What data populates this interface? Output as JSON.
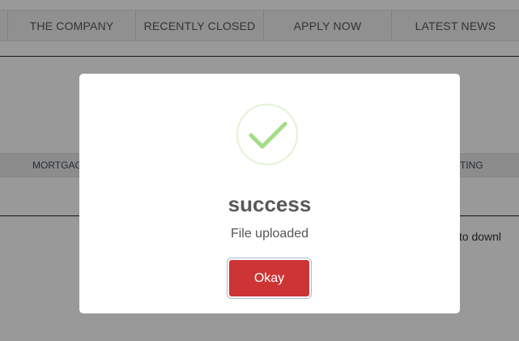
{
  "nav": {
    "items": [
      "THE COMPANY",
      "RECENTLY CLOSED",
      "APPLY NOW",
      "LATEST NEWS"
    ]
  },
  "subnav": {
    "left_label": "MORTGAG",
    "right_label": "RITING"
  },
  "background": {
    "text_fragment": "ile to downl"
  },
  "modal": {
    "icon": "checkmark-icon",
    "title": "success",
    "message": "File uploaded",
    "button_label": "Okay"
  },
  "colors": {
    "button": "#cd3535",
    "checkmark": "#a5dc86",
    "overlay": "rgba(0,0,0,0.4)"
  }
}
